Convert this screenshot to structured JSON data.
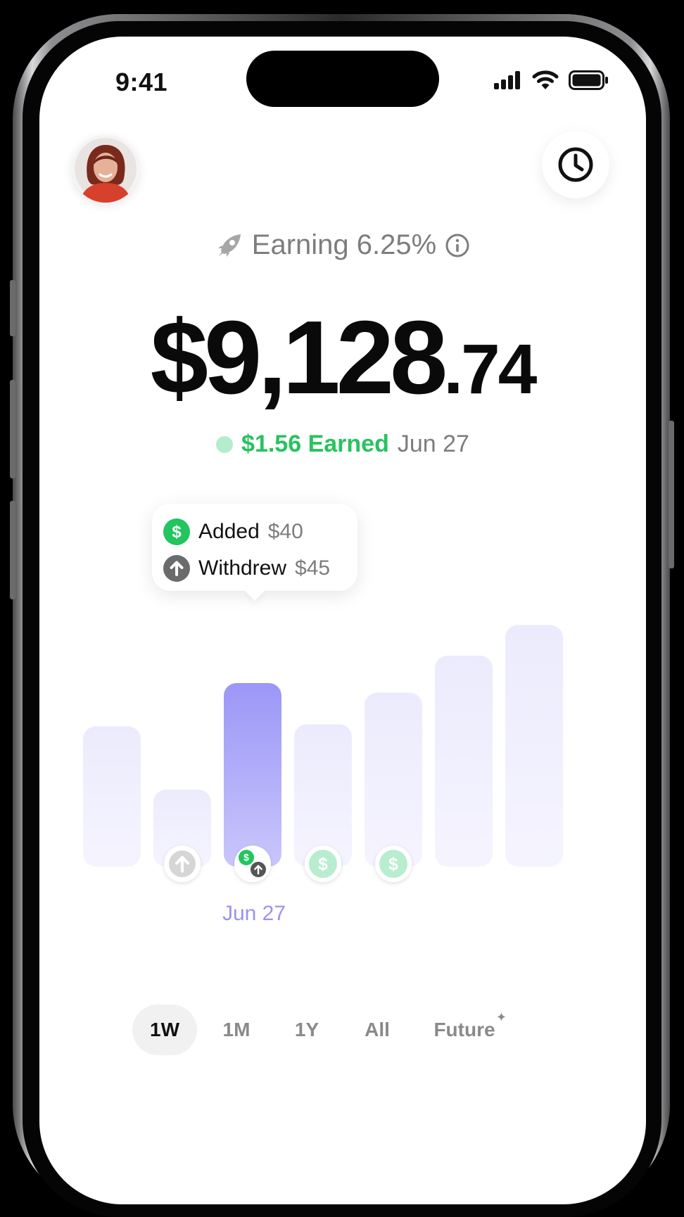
{
  "status_bar": {
    "time": "9:41"
  },
  "header": {
    "avatar_icon": "user-avatar",
    "history_icon": "clock-icon"
  },
  "earning": {
    "label": "Earning 6.25%",
    "icon": "rocket-icon",
    "info_icon": "info-icon"
  },
  "balance": {
    "major": "$9,128",
    "minor": ".74"
  },
  "earned": {
    "amount": "$1.56 Earned",
    "date": "Jun 27"
  },
  "tooltip": {
    "rows": [
      {
        "label": "Added",
        "value": "$40",
        "icon": "dollar-icon",
        "color": "#22c55e"
      },
      {
        "label": "Withdrew",
        "value": "$45",
        "icon": "arrow-up-icon",
        "color": "#6b6b6b"
      }
    ]
  },
  "chart_data": {
    "type": "bar",
    "values": [
      0.665,
      0.365,
      0.87,
      0.675,
      0.825,
      1.0,
      1.145
    ],
    "selected_index": 2,
    "selected_label": "Jun 27",
    "markers": [
      "",
      "withdraw",
      "added+withdraw",
      "added",
      "added",
      "",
      ""
    ],
    "colors": {
      "bar": "#efeefc",
      "selected_top": "#9b97f7",
      "selected_bottom": "#c9c6fb",
      "added": "#b8edd0",
      "withdraw": "#d6d6d6"
    }
  },
  "range_tabs": {
    "items": [
      "1W",
      "1M",
      "1Y",
      "All",
      "Future"
    ],
    "active": "1W"
  }
}
